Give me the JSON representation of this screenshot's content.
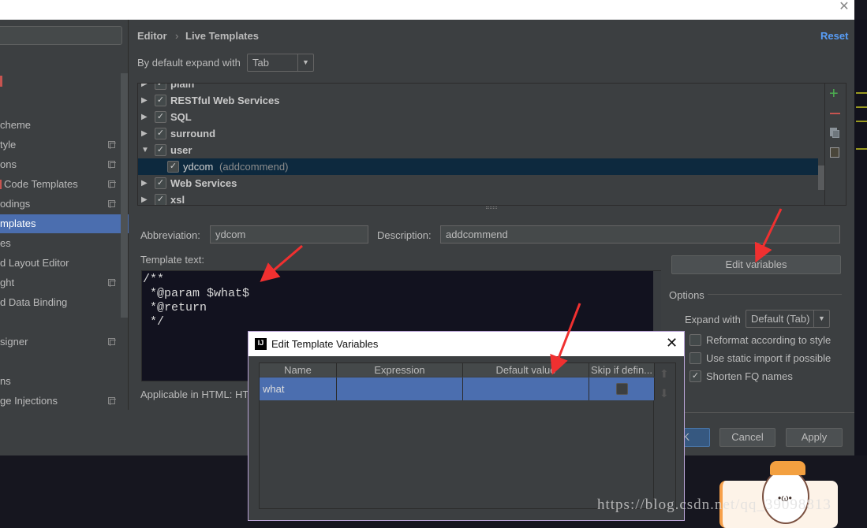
{
  "window": {
    "close_icon": "close-icon"
  },
  "sidebar": {
    "items": [
      {
        "label": "cheme",
        "copy": false
      },
      {
        "label": "tyle",
        "copy": true
      },
      {
        "label": "ons",
        "copy": true
      },
      {
        "label": "Code Templates",
        "copy": true
      },
      {
        "label": "odings",
        "copy": true
      },
      {
        "label": "mplates",
        "copy": false,
        "selected": true
      },
      {
        "label": "es",
        "copy": false
      },
      {
        "label": "d Layout Editor",
        "copy": false
      },
      {
        "label": "ght",
        "copy": true
      },
      {
        "label": "d Data Binding",
        "copy": false
      },
      {
        "label": "signer",
        "copy": true
      },
      {
        "label": "ns",
        "copy": false
      },
      {
        "label": "ge Injections",
        "copy": true
      }
    ]
  },
  "header": {
    "breadcrumb": [
      "Editor",
      "Live Templates"
    ],
    "reset": "Reset",
    "accent": "#589df6"
  },
  "expand": {
    "label": "By default expand with",
    "value": "Tab"
  },
  "tree": {
    "rows": [
      {
        "label": "plain",
        "checked": true,
        "expanded": false
      },
      {
        "label": "RESTful Web Services",
        "checked": true,
        "expanded": false
      },
      {
        "label": "SQL",
        "checked": true,
        "expanded": false
      },
      {
        "label": "surround",
        "checked": true,
        "expanded": false
      },
      {
        "label": "user",
        "checked": true,
        "expanded": true
      },
      {
        "label": "ydcom",
        "desc": "(addcommend)",
        "checked": true,
        "child": true,
        "selected": true
      },
      {
        "label": "Web Services",
        "checked": true,
        "expanded": false
      },
      {
        "label": "xsl",
        "checked": true,
        "expanded": false
      }
    ]
  },
  "form": {
    "abbreviation_label": "Abbreviation:",
    "abbreviation": "ydcom",
    "description_label": "Description:",
    "description": "addcommend",
    "template_label": "Template text:",
    "template_text": "/**\n *@param $what$\n *@return\n */",
    "applicable": "Applicable in HTML: HT",
    "edit_variables": "Edit variables"
  },
  "options": {
    "title": "Options",
    "expand_label": "Expand with",
    "expand_value": "Default (Tab)",
    "checks": [
      {
        "label": "Reformat according to style",
        "checked": false
      },
      {
        "label": "Use static import if possible",
        "checked": false
      },
      {
        "label": "Shorten FQ names",
        "checked": true
      }
    ]
  },
  "buttons": {
    "ok": "K",
    "cancel": "Cancel",
    "apply": "Apply"
  },
  "dialog": {
    "title": "Edit Template Variables",
    "columns": [
      "Name",
      "Expression",
      "Default value",
      "Skip if defin..."
    ],
    "rows": [
      {
        "name": "what",
        "expression": "",
        "default": "",
        "skip": false
      }
    ]
  },
  "watermark": "https://blog.csdn.net/qq_39098813"
}
